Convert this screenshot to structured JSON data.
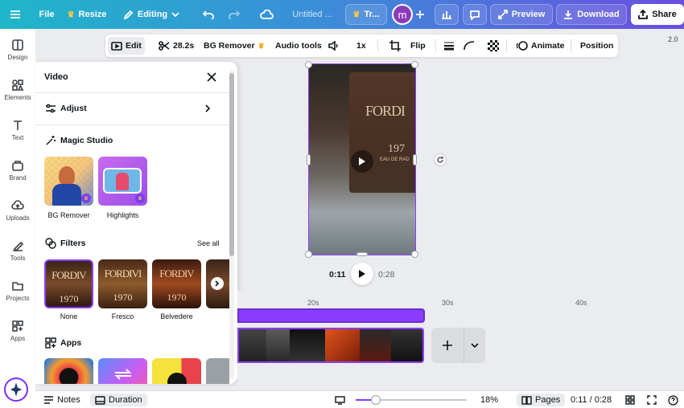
{
  "topbar": {
    "file": "File",
    "resize": "Resize",
    "editing": "Editing",
    "title_placeholder": "Untitled ...",
    "team_label": "Tr...",
    "avatar_letter": "m",
    "preview": "Preview",
    "download": "Download",
    "share": "Share"
  },
  "version": "2.0",
  "rail": {
    "items": [
      {
        "label": "Design",
        "icon": "design-icon"
      },
      {
        "label": "Elements",
        "icon": "elements-icon"
      },
      {
        "label": "Text",
        "icon": "text-icon"
      },
      {
        "label": "Brand",
        "icon": "brand-icon"
      },
      {
        "label": "Uploads",
        "icon": "uploads-icon"
      },
      {
        "label": "Tools",
        "icon": "tools-icon"
      },
      {
        "label": "Projects",
        "icon": "projects-icon"
      },
      {
        "label": "Apps",
        "icon": "apps-icon"
      }
    ]
  },
  "panel": {
    "title": "Video",
    "adjust": "Adjust",
    "magic_studio": "Magic Studio",
    "magic_items": [
      "BG Remover",
      "Highlights"
    ],
    "filters": "Filters",
    "see_all": "See all",
    "filter_items": [
      "None",
      "Fresco",
      "Belvedere"
    ],
    "filter_thumb_text": [
      "FORDIV",
      "FORDIVI",
      "FORDIV"
    ],
    "filter_thumb_year": [
      "1970",
      "1970",
      "1970"
    ],
    "apps": "Apps"
  },
  "toolbar": {
    "edit": "Edit",
    "duration": "28.2s",
    "bg_remover": "BG Remover",
    "audio_tools": "Audio tools",
    "speed": "1x",
    "flip": "Flip",
    "animate": "Animate",
    "position": "Position"
  },
  "video": {
    "overlay_text": "FORDI",
    "overlay_year": "197",
    "overlay_sub": "EAU DE RAD"
  },
  "playback": {
    "current": "0:11",
    "total": "0:28"
  },
  "timeline": {
    "ticks": [
      "20s",
      "30s",
      "40s"
    ]
  },
  "bottombar": {
    "notes": "Notes",
    "duration": "Duration",
    "zoom_value": 0.18,
    "zoom": "18%",
    "pages": "Pages",
    "time": "0:11 / 0:28"
  },
  "colors": {
    "accent": "#8b3dff",
    "topbar_start": "#1fb6c9",
    "topbar_end": "#6a4ee0"
  }
}
